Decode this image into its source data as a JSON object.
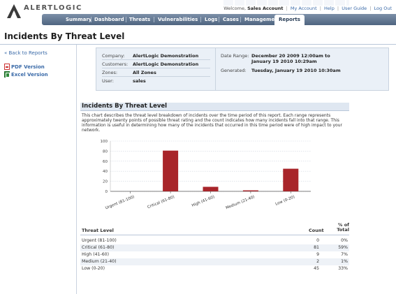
{
  "header": {
    "brand": "ALERTLOGIC",
    "welcome_prefix": "Welcome,",
    "account_name": "Sales Account",
    "links": [
      "My Account",
      "Help",
      "User Guide",
      "Log Out"
    ]
  },
  "nav": {
    "items": [
      "Summary",
      "Dashboard",
      "Threats",
      "Vulnerabilities",
      "Logs",
      "Cases",
      "Management",
      "Reports"
    ],
    "active": "Reports"
  },
  "page": {
    "title": "Incidents By Threat Level"
  },
  "sidebar": {
    "back_label": "« Back to Reports",
    "pdf_label": "PDF Version",
    "excel_label": "Excel Version"
  },
  "info": {
    "company_label": "Company:",
    "company_value": "AlertLogic Demonstration",
    "customers_label": "Customers:",
    "customers_value": "AlertLogic Demonstration",
    "zones_label": "Zones:",
    "zones_value": "All Zones",
    "user_label": "User:",
    "user_value": "sales",
    "date_range_label": "Date Range:",
    "date_range_line1": "December 20 2009 12:00am to",
    "date_range_line2": "January 19 2010 10:29am",
    "generated_label": "Generated:",
    "generated_value": "Tuesday, January 19 2010 10:30am"
  },
  "section": {
    "title": "Incidents By Threat Level",
    "description": "This chart describes the threat level breakdown of incidents over the time period of this report. Each range represents approximately twenty points of possible threat rating and the count indicates how many incidents fall into that range. This information is useful in determining how many of the incidents that occurred in this time period were of high impact to your network."
  },
  "chart_data": {
    "type": "bar",
    "categories": [
      "Urgent (81-100)",
      "Critical (61-80)",
      "High (41-60)",
      "Medium (21-40)",
      "Low (0-20)"
    ],
    "values": [
      0,
      81,
      9,
      2,
      45
    ],
    "ylim": [
      0,
      100
    ],
    "yticks": [
      0,
      20,
      40,
      60,
      80,
      100
    ],
    "grid": true,
    "bar_color": "#a8252a"
  },
  "table": {
    "headers": {
      "level": "Threat Level",
      "count": "Count",
      "pct_line1": "% of",
      "pct_line2": "Total"
    },
    "rows": [
      {
        "level": "Urgent (81-100)",
        "count": "0",
        "pct": "0%"
      },
      {
        "level": "Critical (61-80)",
        "count": "81",
        "pct": "59%"
      },
      {
        "level": "High (41-60)",
        "count": "9",
        "pct": "7%"
      },
      {
        "level": "Medium (21-40)",
        "count": "2",
        "pct": "1%"
      },
      {
        "level": "Low (0-20)",
        "count": "45",
        "pct": "33%"
      }
    ]
  }
}
